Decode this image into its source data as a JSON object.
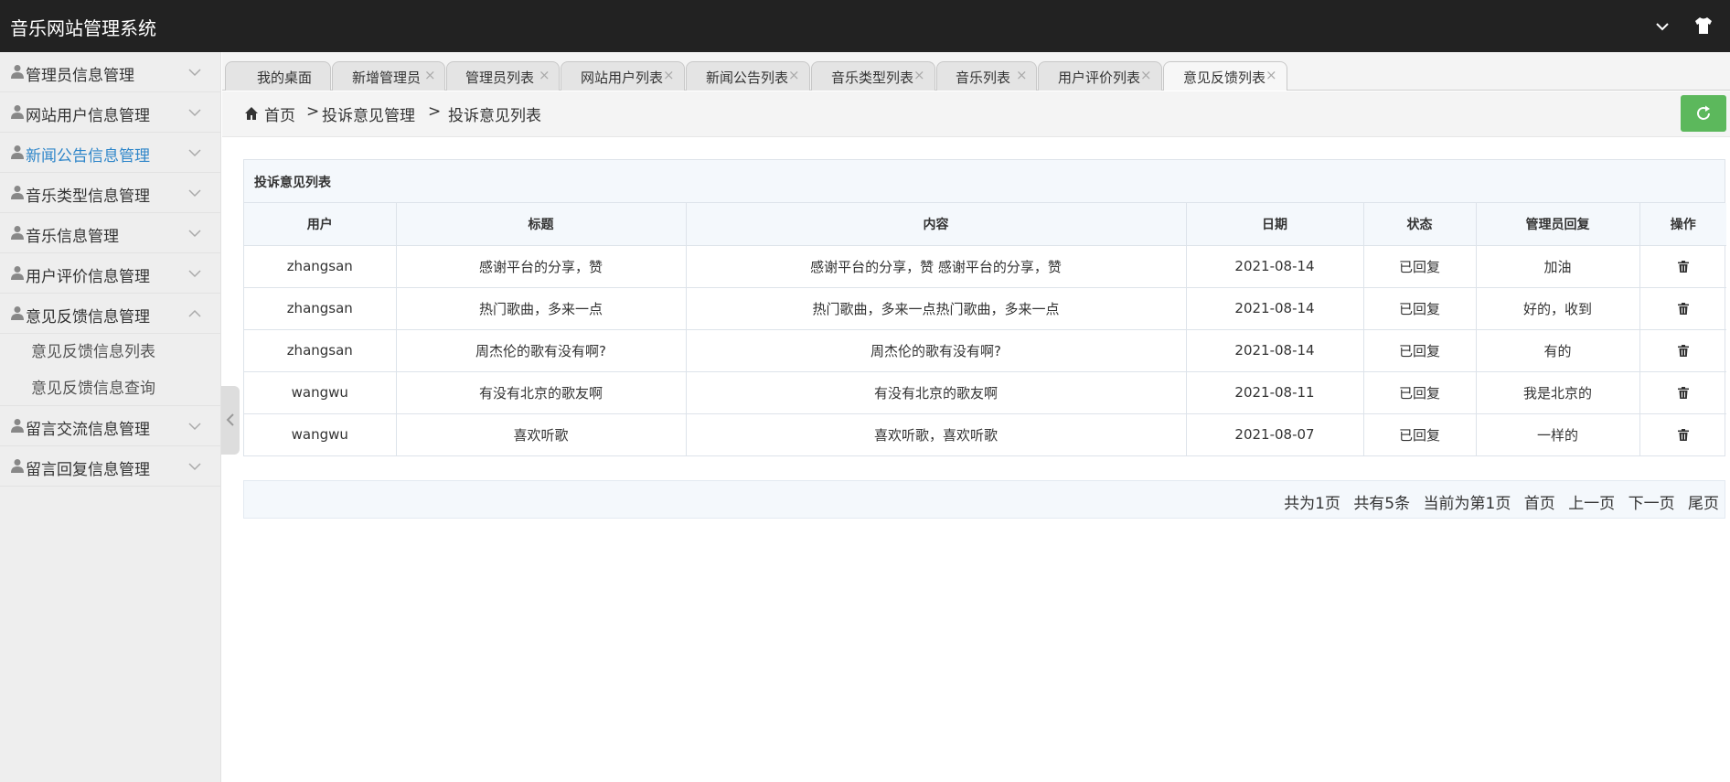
{
  "app": {
    "title": "音乐网站管理系统"
  },
  "header": {
    "icons": [
      "chevron-down-icon",
      "tshirt-icon"
    ]
  },
  "sidebar": {
    "items": [
      {
        "label": "管理员信息管理",
        "expanded": false
      },
      {
        "label": "网站用户信息管理",
        "expanded": false
      },
      {
        "label": "新闻公告信息管理",
        "expanded": false,
        "active": true
      },
      {
        "label": "音乐类型信息管理",
        "expanded": false
      },
      {
        "label": "音乐信息管理",
        "expanded": false
      },
      {
        "label": "用户评价信息管理",
        "expanded": false
      },
      {
        "label": "意见反馈信息管理",
        "expanded": true
      },
      {
        "label": "留言交流信息管理",
        "expanded": false
      },
      {
        "label": "留言回复信息管理",
        "expanded": false
      }
    ],
    "submenu": [
      "意见反馈信息列表",
      "意见反馈信息查询"
    ]
  },
  "tabs": [
    {
      "label": "我的桌面",
      "closable": false
    },
    {
      "label": "新增管理员",
      "closable": true
    },
    {
      "label": "管理员列表",
      "closable": true
    },
    {
      "label": "网站用户列表",
      "closable": true
    },
    {
      "label": "新闻公告列表",
      "closable": true
    },
    {
      "label": "音乐类型列表",
      "closable": true
    },
    {
      "label": "音乐列表",
      "closable": true
    },
    {
      "label": "用户评价列表",
      "closable": true
    },
    {
      "label": "意见反馈列表",
      "closable": true,
      "active": true
    }
  ],
  "tab_close_glyph": "×",
  "breadcrumb": {
    "home": "首页",
    "sep": ">",
    "level1": "投诉意见管理",
    "level2": "投诉意见列表"
  },
  "panel": {
    "title": "投诉意见列表",
    "columns": [
      "用户",
      "标题",
      "内容",
      "日期",
      "状态",
      "管理员回复",
      "操作"
    ],
    "rows": [
      [
        "zhangsan",
        "感谢平台的分享，赞",
        "感谢平台的分享，赞 感谢平台的分享，赞",
        "2021-08-14",
        "已回复",
        "加油"
      ],
      [
        "zhangsan",
        "热门歌曲，多来一点",
        "热门歌曲，多来一点热门歌曲，多来一点",
        "2021-08-14",
        "已回复",
        "好的，收到"
      ],
      [
        "zhangsan",
        "周杰伦的歌有没有啊?",
        "周杰伦的歌有没有啊?",
        "2021-08-14",
        "已回复",
        "有的"
      ],
      [
        "wangwu",
        "有没有北京的歌友啊",
        "有没有北京的歌友啊",
        "2021-08-11",
        "已回复",
        "我是北京的"
      ],
      [
        "wangwu",
        "喜欢听歌",
        "喜欢听歌，喜欢听歌",
        "2021-08-07",
        "已回复",
        "一样的"
      ]
    ]
  },
  "pager": {
    "total_pages": "共为1页",
    "total_items": "共有5条",
    "current": "当前为第1页",
    "first": "首页",
    "prev": "上一页",
    "next": "下一页",
    "last": "尾页"
  },
  "colors": {
    "topbar": "#222222",
    "accent": "#2f86c9",
    "refresh": "#5cb85c"
  }
}
